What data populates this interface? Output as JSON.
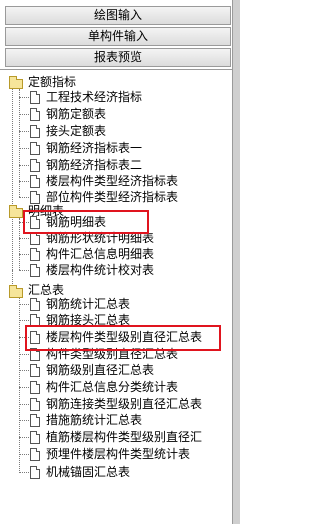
{
  "buttons": {
    "drawing_input": "绘图输入",
    "component_input": "单构件输入",
    "report_preview": "报表预览"
  },
  "tree": {
    "groups": [
      {
        "label": "定额指标",
        "items": [
          "工程技术经济指标",
          "钢筋定额表",
          "接头定额表",
          "钢筋经济指标表一",
          "钢筋经济指标表二",
          "楼层构件类型经济指标表",
          "部位构件类型经济指标表"
        ]
      },
      {
        "label": "明细表",
        "items": [
          "钢筋明细表",
          "钢筋形状统计明细表",
          "构件汇总信息明细表",
          "楼层构件统计校对表"
        ]
      },
      {
        "label": "汇总表",
        "items": [
          "钢筋统计汇总表",
          "钢筋接头汇总表",
          "楼层构件类型级别直径汇总表",
          "构件类型级别直径汇总表",
          "钢筋级别直径汇总表",
          "构件汇总信息分类统计表",
          "钢筋连接类型级别直径汇总表",
          "措施筋统计汇总表",
          "植筋楼层构件类型级别直径汇",
          "预埋件楼层构件类型统计表",
          "机械锚固汇总表"
        ]
      }
    ]
  }
}
